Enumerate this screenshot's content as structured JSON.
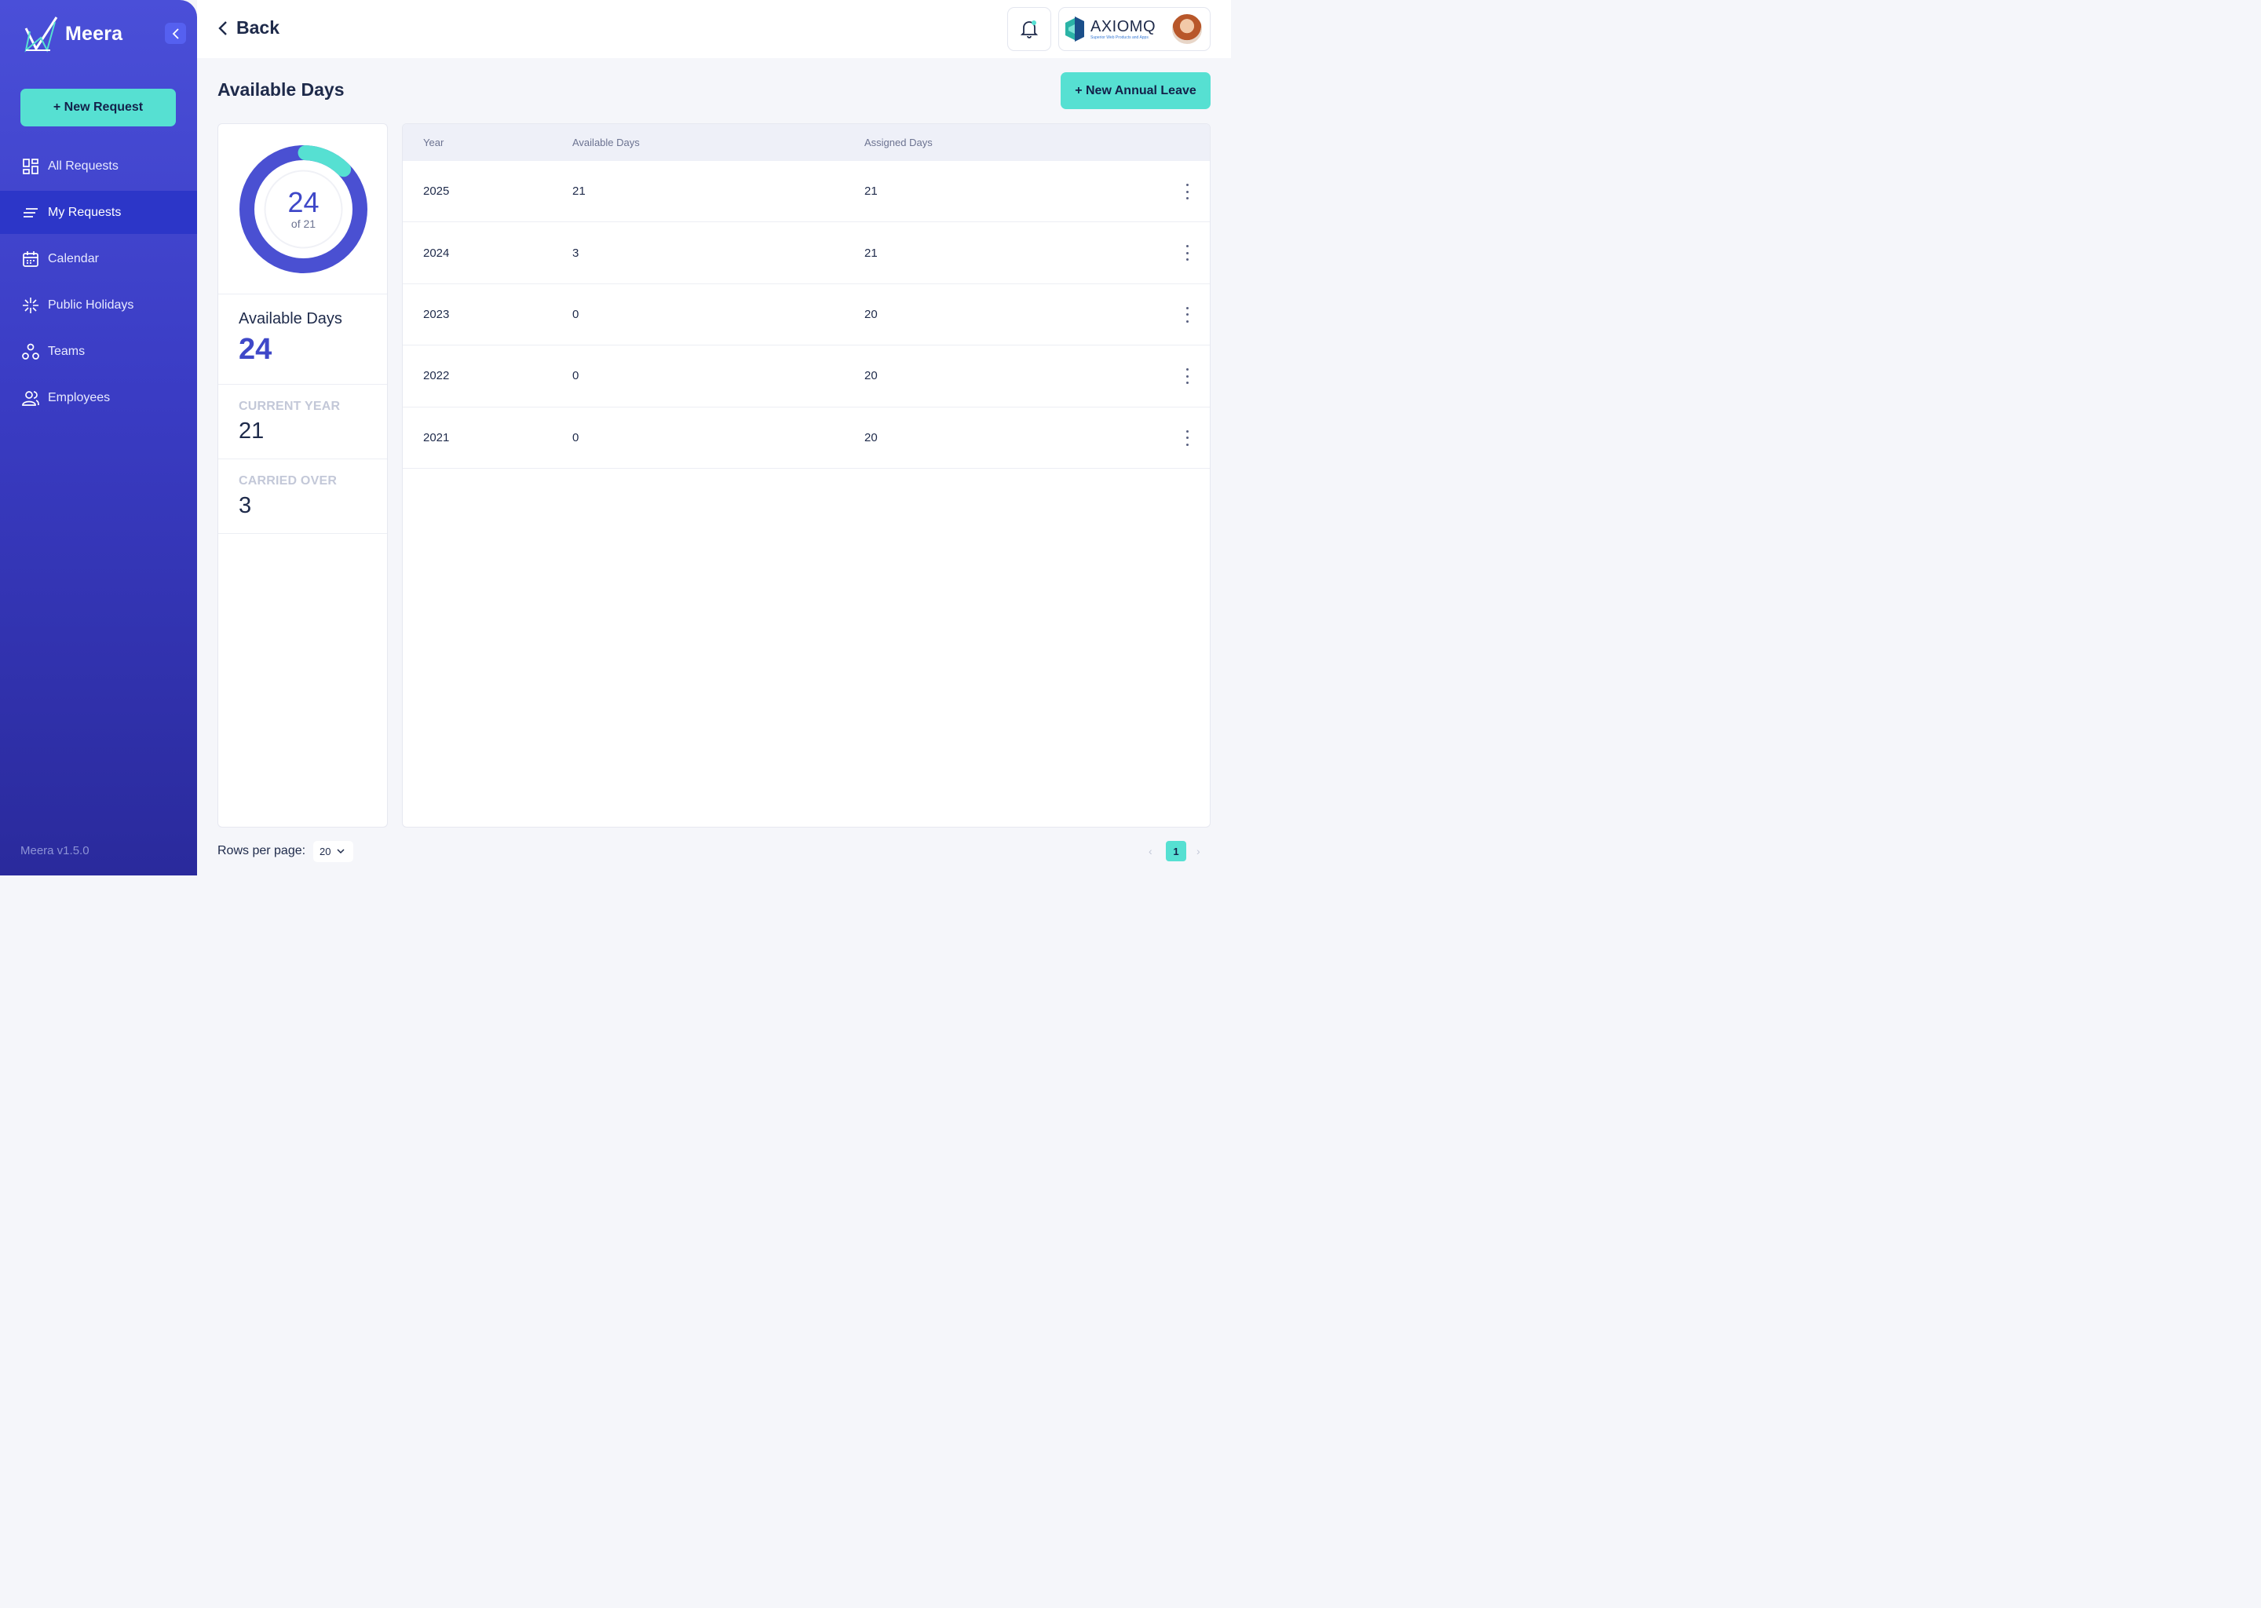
{
  "sidebar": {
    "brand": "Meera",
    "new_request": "+ New Request",
    "items": [
      {
        "label": "All Requests",
        "icon": "grid-icon"
      },
      {
        "label": "My Requests",
        "icon": "list-icon",
        "active": true
      },
      {
        "label": "Calendar",
        "icon": "calendar-icon"
      },
      {
        "label": "Public Holidays",
        "icon": "sparkle-icon"
      },
      {
        "label": "Teams",
        "icon": "teams-icon"
      },
      {
        "label": "Employees",
        "icon": "users-icon"
      }
    ],
    "version": "Meera v1.5.0"
  },
  "topbar": {
    "back": "Back",
    "company": {
      "name": "AXIOMQ",
      "tagline": "Superior Web Products and Apps"
    }
  },
  "page": {
    "title": "Available Days",
    "new_annual_leave": "+ New Annual Leave"
  },
  "summary": {
    "donut_value": "24",
    "donut_of": "of 21",
    "donut_fraction": 0.12,
    "available_label": "Available Days",
    "available_value": "24",
    "current_year_label": "CURRENT YEAR",
    "current_year_value": "21",
    "carried_over_label": "CARRIED OVER",
    "carried_over_value": "3"
  },
  "table": {
    "headers": {
      "year": "Year",
      "available": "Available Days",
      "assigned": "Assigned Days"
    },
    "rows": [
      {
        "year": "2025",
        "available": "21",
        "assigned": "21"
      },
      {
        "year": "2024",
        "available": "3",
        "assigned": "21"
      },
      {
        "year": "2023",
        "available": "0",
        "assigned": "20"
      },
      {
        "year": "2022",
        "available": "0",
        "assigned": "20"
      },
      {
        "year": "2021",
        "available": "0",
        "assigned": "20"
      }
    ]
  },
  "footer": {
    "rows_per_page_label": "Rows per page:",
    "rows_per_page": "20",
    "current_page": "1",
    "prev": "‹",
    "next": "›"
  },
  "colors": {
    "primary": "#3f48c8",
    "accent": "#56e0d2",
    "sidebar": "#3a3cc4"
  }
}
